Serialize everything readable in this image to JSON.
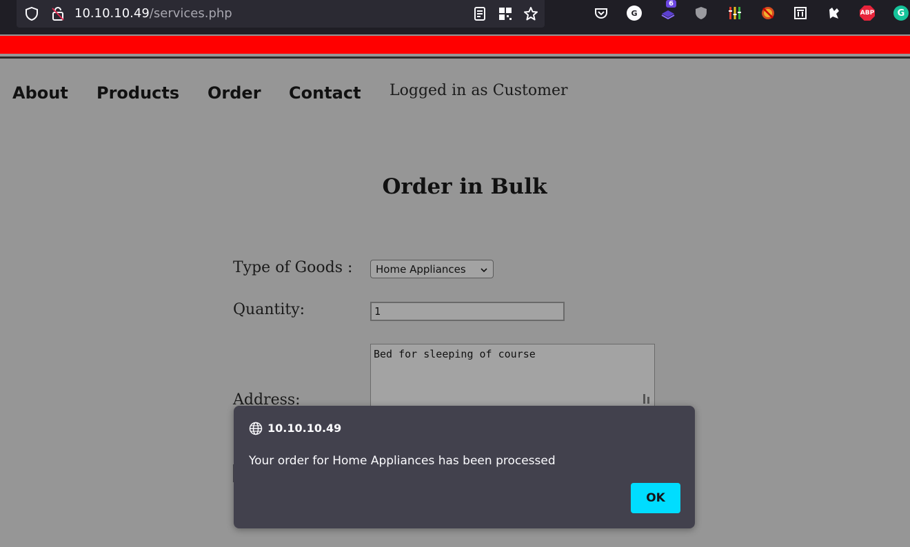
{
  "browser": {
    "url_host": "10.10.10.49",
    "url_path": "/services.php",
    "extensions": [
      {
        "name": "pocket-icon"
      },
      {
        "name": "grammarly-g-icon",
        "label": "G"
      },
      {
        "name": "extension-badge-icon",
        "badge": "6"
      },
      {
        "name": "shield-extension-icon"
      },
      {
        "name": "equalizer-extension-icon"
      },
      {
        "name": "no-script-icon"
      },
      {
        "name": "trash-extension-icon"
      },
      {
        "name": "foxyproxy-icon"
      },
      {
        "name": "adblock-plus-icon",
        "label": "ABP"
      },
      {
        "name": "grammarly-icon",
        "label": "G"
      }
    ]
  },
  "nav": {
    "about": "About",
    "products": "Products",
    "order": "Order",
    "contact": "Contact",
    "status": "Logged in as Customer"
  },
  "page": {
    "title": "Order in Bulk"
  },
  "form": {
    "goods_label": "Type of Goods :",
    "goods_value": "Home Appliances",
    "quantity_label": "Quantity:",
    "quantity_value": "1",
    "address_label": "Address:",
    "address_value": "Bed for sleeping of course"
  },
  "dialog": {
    "title": "10.10.10.49",
    "message": "Your order for Home Appliances has been processed",
    "ok_label": "OK"
  },
  "colors": {
    "page_bg": "#969696",
    "chrome_bg": "#1f1e25",
    "red_bar": "#ff0000",
    "dialog_bg": "#42414d",
    "ok_button": "#00ddff"
  }
}
